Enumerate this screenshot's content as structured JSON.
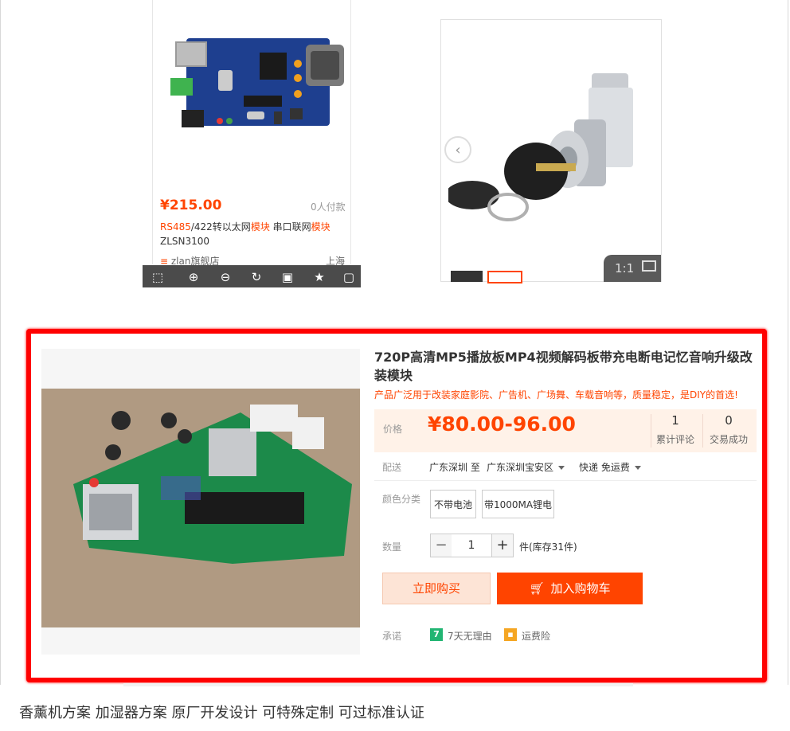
{
  "colors": {
    "accent": "#ff4400",
    "highlight_frame": "#ff0000",
    "price_panel": "#fff2e8"
  },
  "card_top_left": {
    "price": "¥215.00",
    "sales": "0人付款",
    "title_parts": [
      "RS485",
      "/422转以太网",
      "模块",
      " 串口联网",
      "模块"
    ],
    "title_line2": "ZLSN3100",
    "shop": "zlan旗舰店",
    "location": "上海",
    "toolbar_icons": [
      "crop-icon",
      "zoom-in-icon",
      "zoom-out-icon",
      "rotate-icon",
      "save-icon",
      "star-icon",
      "expand-icon"
    ]
  },
  "card_top_right": {
    "prev_arrow": "‹",
    "ratio_label": "1:1"
  },
  "main_product": {
    "title": "720P高清MP5播放板MP4视频解码板带充电断电记忆音响升级改装模块",
    "subtitle": "产品广泛用于改装家庭影院、广告机、广场舞、车载音响等，质量稳定，是DIY的首选!",
    "price_label": "价格",
    "price": "¥80.00-96.00",
    "reviews_count": "1",
    "reviews_label": "累计评论",
    "deals_count": "0",
    "deals_label": "交易成功",
    "shipping_label": "配送",
    "ship_from": "广东深圳 至",
    "ship_to": "广东深圳宝安区",
    "ship_method": "快递 免运费",
    "color_label": "颜色分类",
    "options": [
      "不带电池",
      "带1000MA锂电"
    ],
    "qty_label": "数量",
    "qty_minus": "−",
    "qty_value": "1",
    "qty_plus": "+",
    "stock": "件(库存31件)",
    "buy_now": "立即购买",
    "add_cart": "加入购物车",
    "promise_label": "承诺",
    "promise_1": "7天无理由",
    "promise_2": "运费险"
  },
  "bottom": {
    "title": "香薰机方案 加湿器方案 原厂开发设计 可特殊定制 可过标准认证"
  }
}
